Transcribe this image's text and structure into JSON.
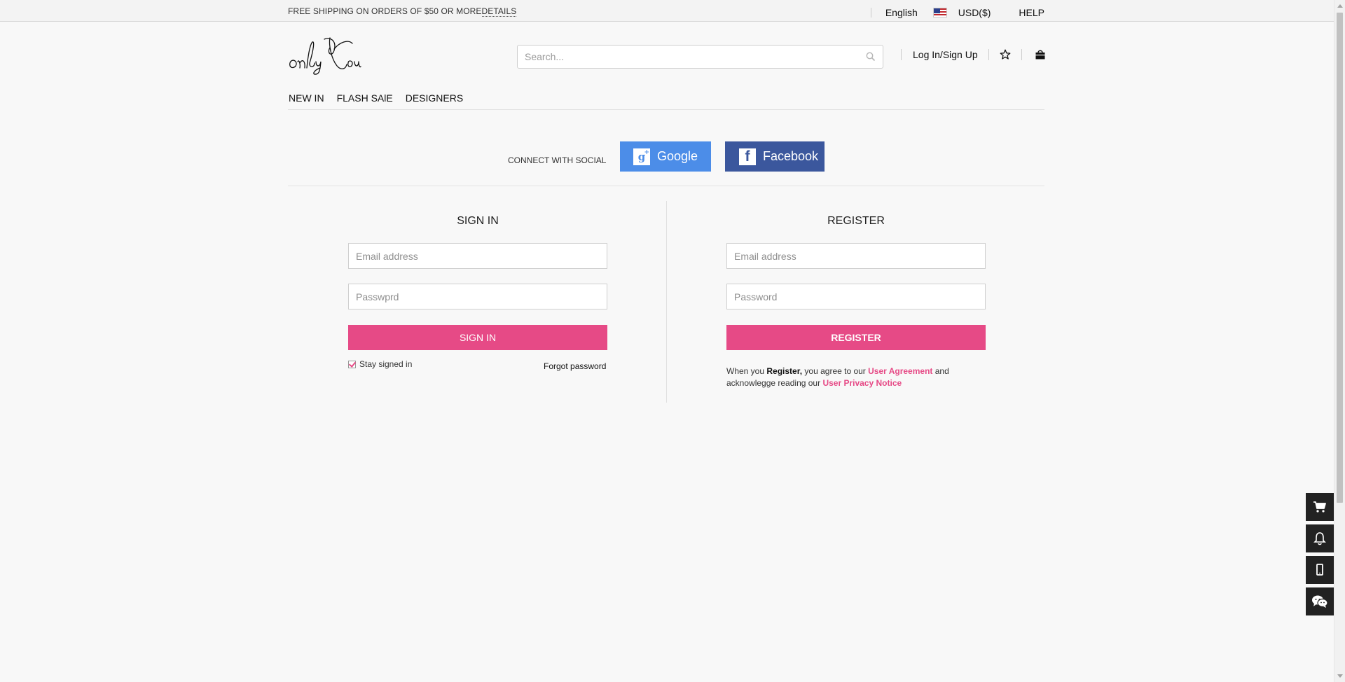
{
  "topbar": {
    "shipping_text": "FREE SHIPPING ON ORDERS OF $50 OR MORE",
    "details_link": "DETAILS",
    "language": "English",
    "currency": "USD($)",
    "help": "HELP"
  },
  "header": {
    "logo_text": "onlyYou",
    "search_placeholder": "Search...",
    "login_label": "Log In/Sign Up"
  },
  "nav": {
    "items": [
      "NEW IN",
      "FLASH SAlE",
      "DESIGNERS"
    ]
  },
  "social": {
    "label": "CONNECT WITH SOCIAL",
    "google": "Google",
    "facebook": "Facebook"
  },
  "signin": {
    "title": "SIGN IN",
    "email_placeholder": "Email address",
    "password_placeholder": "Passwprd",
    "button": "SIGN IN",
    "stay_signed_in": "Stay signed in",
    "forgot": "Forgot password"
  },
  "register": {
    "title": "REGISTER",
    "email_placeholder": "Email address",
    "password_placeholder": "Password",
    "button": "REGISTER",
    "terms_1": "When you ",
    "terms_bold": "Register,",
    "terms_2": " you agree to our ",
    "terms_link1": "User Agreement",
    "terms_3": " and acknowlegge reading our ",
    "terms_link2": "User Privacy Notice"
  },
  "side_tools": [
    "cart-icon",
    "bell-icon",
    "mobile-icon",
    "wechat-icon"
  ],
  "colors": {
    "accent_pink": "#e64a86",
    "google_blue": "#4c8de8",
    "facebook_blue": "#3b579d"
  }
}
